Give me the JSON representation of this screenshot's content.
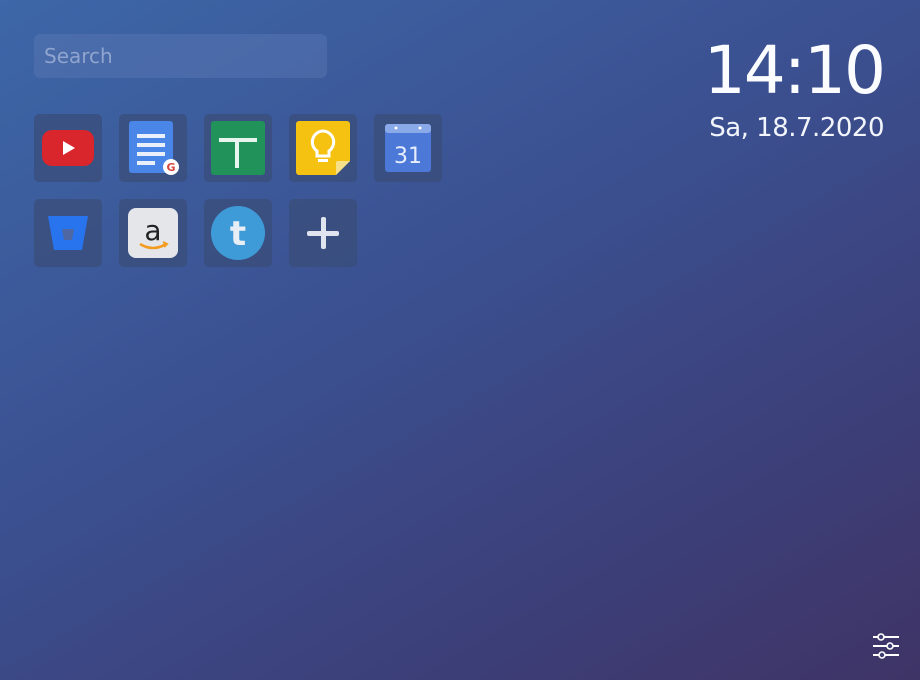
{
  "search": {
    "placeholder": "Search",
    "value": ""
  },
  "clock": {
    "time": "14:10",
    "date": "Sa, 18.7.2020"
  },
  "shortcuts": [
    {
      "icon": "youtube-icon"
    },
    {
      "icon": "google-docs-icon"
    },
    {
      "icon": "google-sheets-icon"
    },
    {
      "icon": "google-keep-icon"
    },
    {
      "icon": "google-calendar-icon",
      "label": "31"
    },
    {
      "icon": "bitbucket-icon"
    },
    {
      "icon": "amazon-icon",
      "label": "a"
    },
    {
      "icon": "tumblr-icon",
      "label": "t"
    },
    {
      "icon": "add-icon"
    }
  ],
  "settings": {
    "icon": "sliders-icon"
  },
  "colors": {
    "youtube": "#d8262c",
    "docs": "#4a86e8",
    "sheets": "#21935a",
    "keep": "#f5c211",
    "calendar": "#4c78d8",
    "bitbucket": "#2873ee",
    "tumblr": "#3f9bd8"
  }
}
